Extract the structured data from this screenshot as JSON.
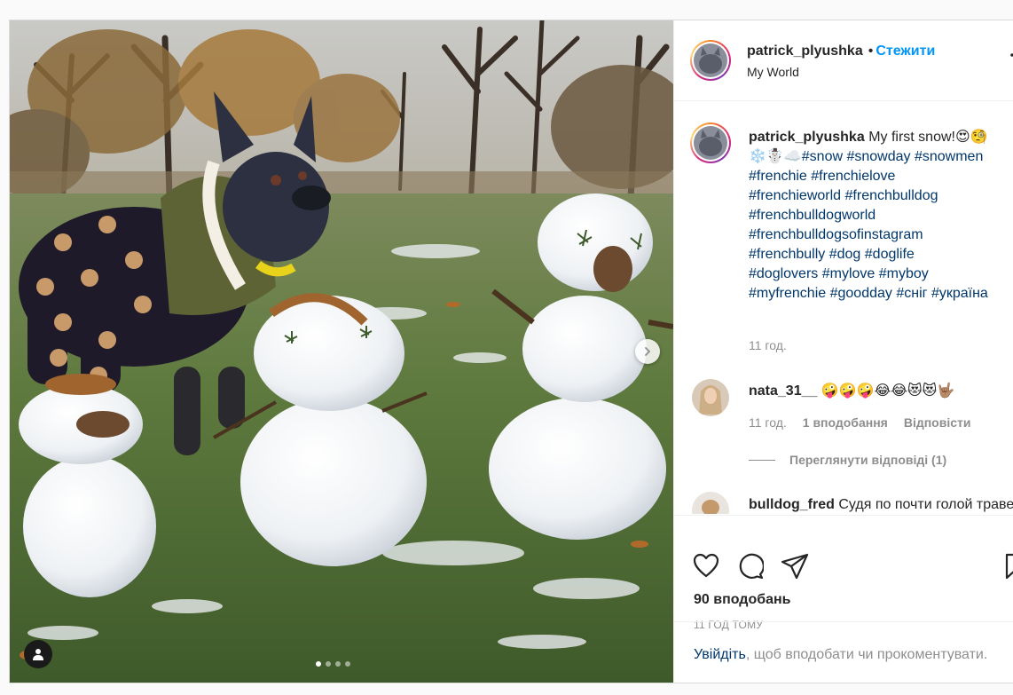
{
  "post": {
    "username": "patrick_plyushka",
    "separator": "•",
    "follow_label": "Стежити",
    "location": "My World"
  },
  "caption": {
    "username": "patrick_plyushka",
    "text_start": "My first snow!😍🧐",
    "emoji_line": "❄️☃️☁️",
    "hashtags": [
      "#snow",
      "#snowday",
      "#snowmen",
      "#frenchie",
      "#frenchielove",
      "#frenchieworld",
      "#frenchbulldog",
      "#frenchbulldogworld",
      "#frenchbulldogsofinstagram",
      "#frenchbully",
      "#dog",
      "#doglife",
      "#doglovers",
      "#mylove",
      "#myboy",
      "#myfrenchie",
      "#goodday",
      "#сніг",
      "#україна"
    ],
    "time": "11 год."
  },
  "comments": [
    {
      "username": "nata_31__",
      "text": "🤪🤪🤪😂😂😻😻🤟🏽",
      "time": "11 год.",
      "likes": "1 вподобання",
      "reply": "Відповісти",
      "view_replies": "Переглянути відповіді (1)"
    },
    {
      "username": "bulldog_fred",
      "text": "Судя по почти голой траве вокруг, ты собрал весь снег"
    }
  ],
  "actions": {
    "likes": "90 вподобань",
    "posted_ago": "11 ГОД ТОМУ"
  },
  "login": {
    "link": "Увійдіть",
    "rest": ", щоб вподобати чи прокоментувати."
  },
  "carousel": {
    "total": 4,
    "active": 1
  },
  "icons": {
    "heart": "heart-icon",
    "comment": "comment-icon",
    "share": "share-icon",
    "save": "bookmark-icon",
    "more": "more-icon",
    "next": "chevron-right-icon",
    "tag": "user-tag-icon"
  }
}
